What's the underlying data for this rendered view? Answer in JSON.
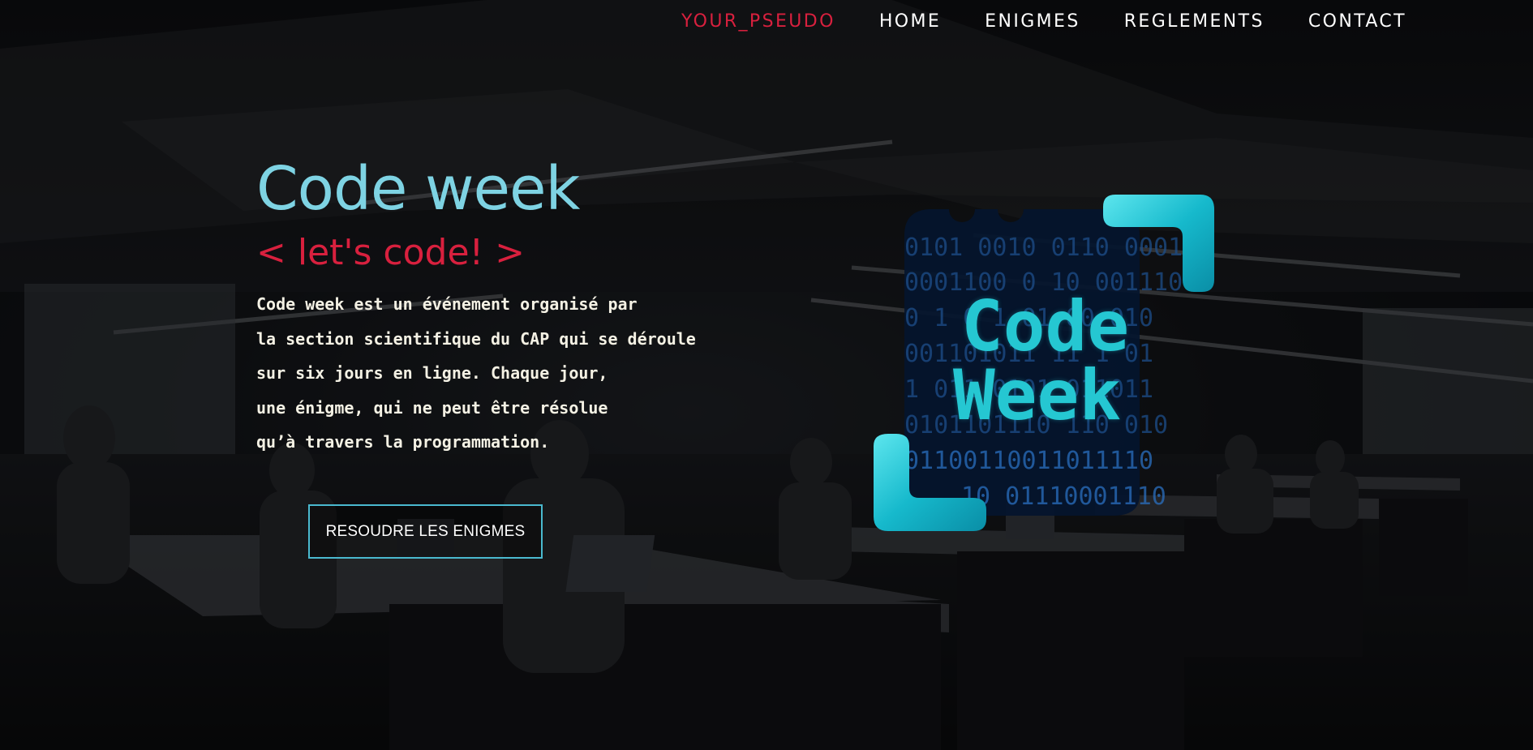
{
  "nav": {
    "items": [
      {
        "label": "YOUR_PSEUDO",
        "accent": true
      },
      {
        "label": "HOME"
      },
      {
        "label": "ENIGMES"
      },
      {
        "label": "REGLEMENTS"
      },
      {
        "label": "CONTACT"
      }
    ]
  },
  "hero": {
    "title": "Code week",
    "subtitle": "< let's code! >",
    "description_lines": [
      "Code week est un événement organisé par",
      "la section scientifique du CAP qui se déroule",
      "sur six jours en ligne. Chaque jour,",
      "une énigme, qui ne peut être résolue",
      "qu’à travers la programmation."
    ],
    "cta_label": "RESOUDRE LES ENIGMES"
  },
  "logo": {
    "line1": "Code",
    "line2": "Week",
    "binary_rows": [
      "0101 0010 0110 0001",
      "0001100 0 10 001110",
      "0 1 0  1 01 00 010",
      "001101011  11 1 01",
      "1 011 0101   011011",
      "0101101110 110 010",
      "01100110011011110",
      "10 01110001110"
    ]
  },
  "colors": {
    "accent_red": "#d8203e",
    "title_cyan": "#7ed3e3",
    "button_border": "#4ab9cf",
    "logo_cyan": "#25c7d2",
    "logo_panel": "#04152e"
  }
}
